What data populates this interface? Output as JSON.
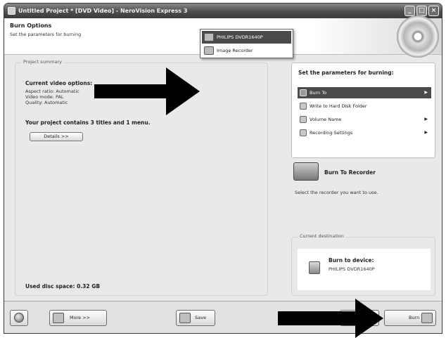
{
  "window": {
    "title": "Untitled Project * [DVD Video] - NeroVision Express 3",
    "controls": {
      "minimize": "_",
      "maximize": "□",
      "close": "×"
    }
  },
  "header": {
    "title": "Burn Options",
    "subtitle": "Set the parameters for burning"
  },
  "summary": {
    "legend": "Project summary",
    "current_title": "Current video options:",
    "lines": [
      "Aspect ratio: Automatic",
      "Video mode: PAL",
      "Quality: Automatic"
    ],
    "contains": "Your project contains 3 titles and 1 menu.",
    "details_button": "Details >>",
    "used_space": "Used disc space: 0.32 GB"
  },
  "burn_panel": {
    "title": "Set the parameters for burning:",
    "items": [
      {
        "label": "Burn To",
        "icon": "burn-disc-icon",
        "has_submenu": true,
        "selected": true
      },
      {
        "label": "Write to Hard Disk Folder",
        "icon": "folder-icon",
        "has_submenu": false,
        "selected": false
      },
      {
        "label": "Volume Name",
        "icon": "volume-icon",
        "has_submenu": true,
        "selected": false
      },
      {
        "label": "Recording Settings",
        "icon": "settings-icon",
        "has_submenu": true,
        "selected": false
      }
    ]
  },
  "popup": {
    "items": [
      {
        "label": "PHILIPS DVDR1640P",
        "icon": "recorder-icon",
        "selected": true
      },
      {
        "label": "Image Recorder",
        "icon": "image-recorder-icon",
        "selected": false
      }
    ]
  },
  "burn_to_recorder": {
    "title": "Burn To Recorder",
    "description": "Select the recorder you want to use."
  },
  "destination": {
    "legend": "Current destination",
    "title": "Burn to device:",
    "device": "PHILIPS DVDR1640P"
  },
  "footer": {
    "more_button": "More >>",
    "save_button": "Save",
    "burn_button": "Burn"
  },
  "colors": {
    "highlight": "#4a4a4a",
    "window_bg": "#e9e9e6",
    "arrow": "#000000"
  }
}
